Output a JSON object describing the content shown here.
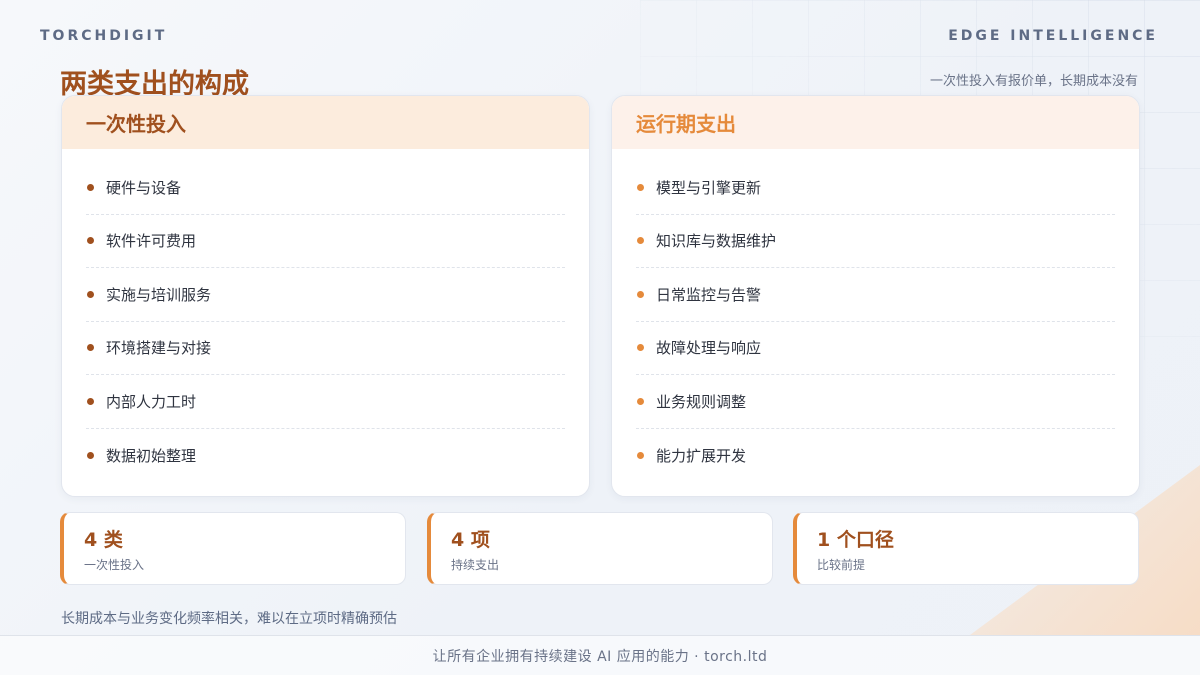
{
  "header": {
    "brand_left": "TORCHDIGIT",
    "brand_right": "EDGE INTELLIGENCE",
    "title": "两类支出的构成",
    "subtitle": "一次性投入有报价单，长期成本没有"
  },
  "cards": [
    {
      "title": "一次性投入",
      "items": [
        "硬件与设备",
        "软件许可费用",
        "实施与培训服务",
        "环境搭建与对接",
        "内部人力工时",
        "数据初始整理"
      ]
    },
    {
      "title": "运行期支出",
      "items": [
        "模型与引擎更新",
        "知识库与数据维护",
        "日常监控与告警",
        "故障处理与响应",
        "业务规则调整",
        "能力扩展开发"
      ]
    }
  ],
  "stats": [
    {
      "value": "4 类",
      "label": "一次性投入"
    },
    {
      "value": "4 项",
      "label": "持续支出"
    },
    {
      "value": "1 个口径",
      "label": "比较前提"
    }
  ],
  "note": "长期成本与业务变化频率相关，难以在立项时精确预估",
  "footer": "让所有企业拥有持续建设 AI 应用的能力 · torch.ltd",
  "colors": {
    "primary": "#a0501e",
    "accent": "#e58a3b",
    "muted": "#6a7388"
  }
}
